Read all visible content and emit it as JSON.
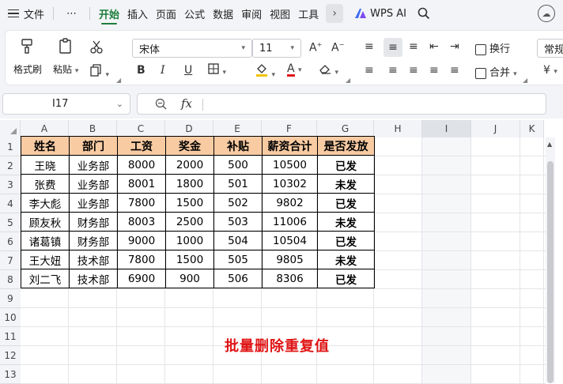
{
  "menubar": {
    "file": "文件",
    "more": "⋯",
    "tabs": [
      "开始",
      "插入",
      "页面",
      "公式",
      "数据",
      "审阅",
      "视图",
      "工具"
    ],
    "active_tab": "开始",
    "wps_ai": "WPS AI"
  },
  "ribbon": {
    "format_painter": "格式刷",
    "paste": "粘贴",
    "font_name": "宋体",
    "font_size": "11",
    "bold": "B",
    "italic": "I",
    "underline": "U",
    "wrap": "换行",
    "merge": "合并",
    "number_format": "常规",
    "currency": "¥"
  },
  "formula_bar": {
    "cell_ref": "I17",
    "fx": "fx",
    "content": ""
  },
  "columns": [
    "A",
    "B",
    "C",
    "D",
    "E",
    "F",
    "G",
    "H",
    "I",
    "J",
    "K"
  ],
  "rows": [
    "1",
    "2",
    "3",
    "4",
    "5",
    "6",
    "7",
    "8",
    "9",
    "10",
    "11",
    "12",
    "13"
  ],
  "table": {
    "headers": [
      "姓名",
      "部门",
      "工资",
      "奖金",
      "补贴",
      "薪资合计",
      "是否发放"
    ],
    "rows": [
      [
        "王晓",
        "业务部",
        "8000",
        "2000",
        "500",
        "10500",
        "已发"
      ],
      [
        "张费",
        "业务部",
        "8001",
        "1800",
        "501",
        "10302",
        "未发"
      ],
      [
        "李大彪",
        "业务部",
        "7800",
        "1500",
        "502",
        "9802",
        "已发"
      ],
      [
        "顾友秋",
        "财务部",
        "8003",
        "2500",
        "503",
        "11006",
        "未发"
      ],
      [
        "诸葛镇",
        "财务部",
        "9000",
        "1000",
        "504",
        "10504",
        "已发"
      ],
      [
        "王大妞",
        "技术部",
        "7800",
        "1500",
        "505",
        "9805",
        "未发"
      ],
      [
        "刘二飞",
        "技术部",
        "6900",
        "900",
        "506",
        "8306",
        "已发"
      ]
    ]
  },
  "caption": "批量删除重复值",
  "colors": {
    "header_fill": "#f8cba3",
    "status_red": "#e01515",
    "active_tab": "#1b7d3a"
  }
}
